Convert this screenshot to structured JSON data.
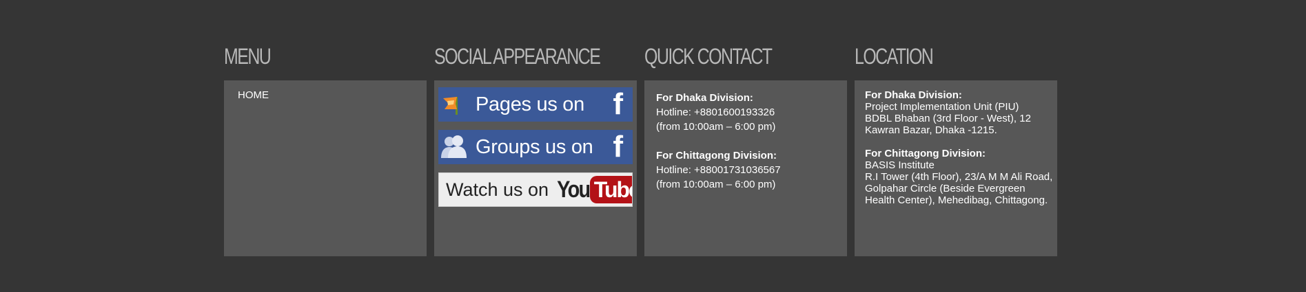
{
  "menu": {
    "title": "MENU",
    "items": [
      {
        "label": "HOME"
      }
    ]
  },
  "social": {
    "title": "SOCIAL APPEARANCE",
    "pages_label": "Pages us on",
    "groups_label": "Groups us on",
    "fb_letter": "f",
    "youtube_label": "Watch us on",
    "youtube_you": "You",
    "youtube_tube": "Tube",
    "colors": {
      "facebook": "#3b5998",
      "youtube": "#b31217"
    }
  },
  "contact": {
    "title": "QUICK CONTACT",
    "blocks": [
      {
        "heading": "For Dhaka Division:",
        "hotline": "Hotline: +8801600193326",
        "hours": "(from 10:00am – 6:00 pm)"
      },
      {
        "heading": "For Chittagong Division:",
        "hotline": "Hotline: +88001731036567",
        "hours": "(from 10:00am – 6:00 pm)"
      }
    ]
  },
  "location": {
    "title": "LOCATION",
    "blocks": [
      {
        "heading": "For Dhaka Division:",
        "lines": [
          "Project Implementation Unit (PIU)",
          "BDBL Bhaban (3rd Floor - West), 12",
          "Kawran Bazar, Dhaka -1215."
        ]
      },
      {
        "heading": "For Chittagong Division:",
        "lines": [
          "BASIS Institute",
          "R.I Tower (4th Floor), 23/A M M Ali Road,",
          "Golpahar Circle (Beside Evergreen",
          "Health Center), Mehedibag, Chittagong."
        ]
      }
    ]
  }
}
